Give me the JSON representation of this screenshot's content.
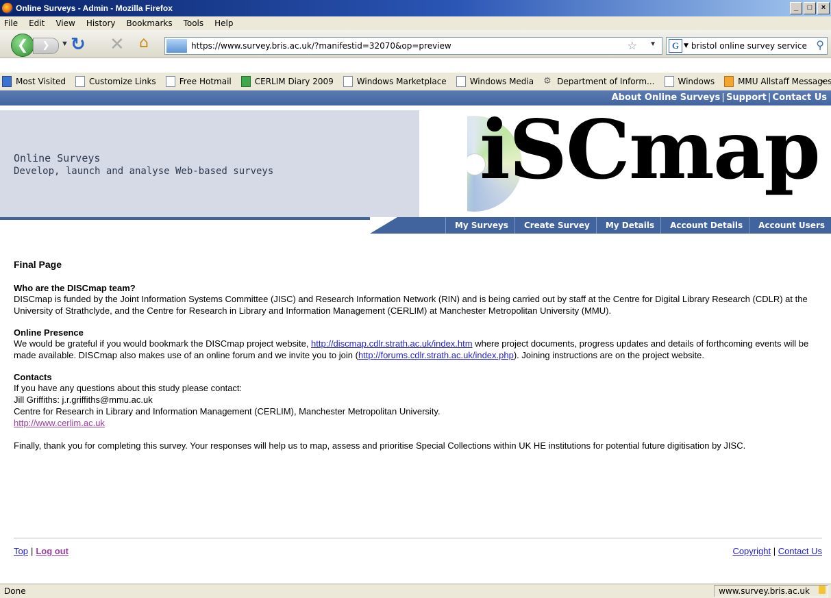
{
  "window": {
    "title": "Online Surveys - Admin - Mozilla Firefox",
    "min": "_",
    "max": "□",
    "close": "×"
  },
  "menu": [
    "File",
    "Edit",
    "View",
    "History",
    "Bookmarks",
    "Tools",
    "Help"
  ],
  "nav": {
    "url": "https://www.survey.bris.ac.uk/?manifestid=32070&op=preview",
    "search_value": "bristol online survey service",
    "search_engine_letter": "G"
  },
  "bookmarks": [
    {
      "label": "Most Visited",
      "icon": "most-visited-icon"
    },
    {
      "label": "Customize Links",
      "icon": "page-icon"
    },
    {
      "label": "Free Hotmail",
      "icon": "page-icon"
    },
    {
      "label": "CERLIM Diary 2009",
      "icon": "calendar-icon"
    },
    {
      "label": "Windows Marketplace",
      "icon": "page-icon"
    },
    {
      "label": "Windows Media",
      "icon": "page-icon"
    },
    {
      "label": "Department of Inform...",
      "icon": "gear-icon"
    },
    {
      "label": "Windows",
      "icon": "page-icon"
    },
    {
      "label": "MMU Allstaff Messages",
      "icon": "rss-icon"
    }
  ],
  "bookmarks_more": "»",
  "site": {
    "top_links": [
      "About Online Surveys",
      "Support",
      "Contact Us"
    ],
    "title": "Online Surveys",
    "subtitle": "Develop, launch and analyse Web-based surveys",
    "logo_text": "iSCmap",
    "tabs": [
      "My Surveys",
      "Create Survey",
      "My Details",
      "Account Details",
      "Account Users"
    ]
  },
  "page": {
    "heading": "Final Page",
    "s1_title": "Who are the DISCmap team?",
    "s1_text": "DISCmap is funded by the Joint Information Systems Committee (JISC) and Research Information Network (RIN) and is being carried out by staff at the Centre for Digital Library Research (CDLR) at the University of Strathclyde, and the Centre for Research in Library and Information Management (CERLIM) at Manchester Metropolitan University (MMU).",
    "s2_title": "Online Presence",
    "s2_text_a": "We would be grateful if you would bookmark the DISCmap project website, ",
    "s2_link1": "http://discmap.cdlr.strath.ac.uk/index.htm",
    "s2_text_b": " where project documents, progress updates and details of forthcoming events will be made available. DISCmap also makes use of an online forum and we invite you to join (",
    "s2_link2": "http://forums.cdlr.strath.ac.uk/index.php",
    "s2_text_c": "). Joining instructions are on the project website.",
    "s3_title": "Contacts",
    "s3_line1": "If you have any questions about this study please contact:",
    "s3_line2": "Jill Griffiths: j.r.griffiths@mmu.ac.uk",
    "s3_line3": "Centre for Research in Library and Information Management (CERLIM), Manchester Metropolitan University.",
    "s3_link": "http://www.cerlim.ac.uk",
    "closing": "Finally, thank you for completing this survey. Your responses will help us to map, assess and prioritise Special Collections within UK HE institutions for potential future digitisation by JISC."
  },
  "footer": {
    "top": "Top",
    "logout": "Log out",
    "copyright": "Copyright",
    "contact": "Contact Us"
  },
  "status": {
    "text": "Done",
    "host": "www.survey.bris.ac.uk"
  }
}
